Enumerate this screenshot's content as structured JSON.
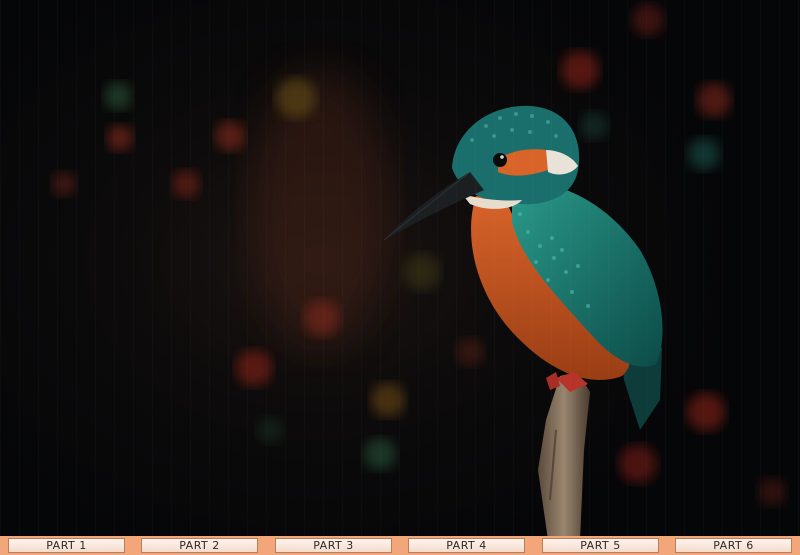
{
  "tabs": [
    {
      "label": "PART 1"
    },
    {
      "label": "PART 2"
    },
    {
      "label": "PART 3"
    },
    {
      "label": "PART 4"
    },
    {
      "label": "PART 5"
    },
    {
      "label": "PART 6"
    }
  ],
  "colors": {
    "tab_bar": "#f2a679",
    "background": "#050608",
    "bird_teal": "#1d7c73",
    "bird_orange": "#c85a22"
  }
}
